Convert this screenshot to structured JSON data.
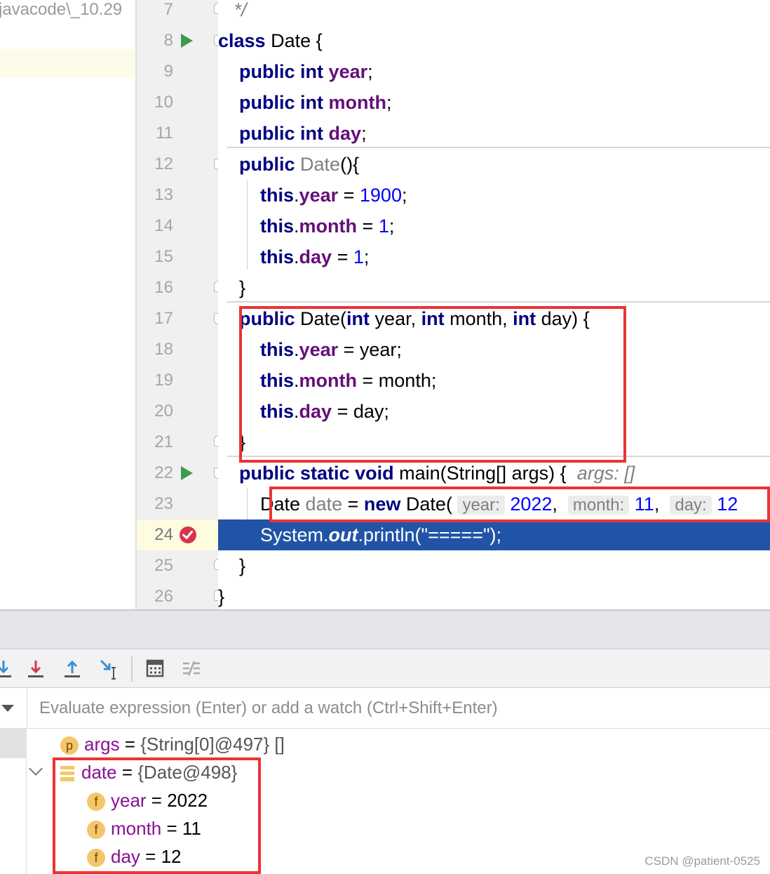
{
  "project": {
    "label": "javacode\\_10.29"
  },
  "editor": {
    "lines": [
      {
        "num": "7",
        "parts": [
          {
            "t": "   */",
            "c": "cmt"
          }
        ]
      },
      {
        "num": "8",
        "parts": [
          {
            "t": "class",
            "c": "kw"
          },
          {
            "t": " Date {"
          }
        ]
      },
      {
        "num": "9",
        "parts": [
          {
            "t": "    "
          },
          {
            "t": "public",
            "c": "kw"
          },
          {
            "t": " "
          },
          {
            "t": "int",
            "c": "kw"
          },
          {
            "t": " "
          },
          {
            "t": "year",
            "c": "fld"
          },
          {
            "t": ";"
          }
        ]
      },
      {
        "num": "10",
        "parts": [
          {
            "t": "    "
          },
          {
            "t": "public",
            "c": "kw"
          },
          {
            "t": " "
          },
          {
            "t": "int",
            "c": "kw"
          },
          {
            "t": " "
          },
          {
            "t": "month",
            "c": "fld"
          },
          {
            "t": ";"
          }
        ]
      },
      {
        "num": "11",
        "parts": [
          {
            "t": "    "
          },
          {
            "t": "public",
            "c": "kw"
          },
          {
            "t": " "
          },
          {
            "t": "int",
            "c": "kw"
          },
          {
            "t": " "
          },
          {
            "t": "day",
            "c": "fld"
          },
          {
            "t": ";"
          }
        ]
      },
      {
        "num": "12",
        "parts": [
          {
            "t": "    "
          },
          {
            "t": "public",
            "c": "kw"
          },
          {
            "t": " "
          },
          {
            "t": "Date",
            "c": "gray"
          },
          {
            "t": "(){"
          }
        ]
      },
      {
        "num": "13",
        "parts": [
          {
            "t": "        "
          },
          {
            "t": "this",
            "c": "kw"
          },
          {
            "t": "."
          },
          {
            "t": "year",
            "c": "fld"
          },
          {
            "t": " = "
          },
          {
            "t": "1900",
            "c": "num"
          },
          {
            "t": ";"
          }
        ]
      },
      {
        "num": "14",
        "parts": [
          {
            "t": "        "
          },
          {
            "t": "this",
            "c": "kw"
          },
          {
            "t": "."
          },
          {
            "t": "month",
            "c": "fld"
          },
          {
            "t": " = "
          },
          {
            "t": "1",
            "c": "num"
          },
          {
            "t": ";"
          }
        ]
      },
      {
        "num": "15",
        "parts": [
          {
            "t": "        "
          },
          {
            "t": "this",
            "c": "kw"
          },
          {
            "t": "."
          },
          {
            "t": "day",
            "c": "fld"
          },
          {
            "t": " = "
          },
          {
            "t": "1",
            "c": "num"
          },
          {
            "t": ";"
          }
        ]
      },
      {
        "num": "16",
        "parts": [
          {
            "t": "    }"
          }
        ]
      },
      {
        "num": "17",
        "parts": [
          {
            "t": "    "
          },
          {
            "t": "public",
            "c": "kw"
          },
          {
            "t": " Date("
          },
          {
            "t": "int",
            "c": "kw"
          },
          {
            "t": " year, "
          },
          {
            "t": "int",
            "c": "kw"
          },
          {
            "t": " month, "
          },
          {
            "t": "int",
            "c": "kw"
          },
          {
            "t": " day) {"
          }
        ]
      },
      {
        "num": "18",
        "parts": [
          {
            "t": "        "
          },
          {
            "t": "this",
            "c": "kw"
          },
          {
            "t": "."
          },
          {
            "t": "year",
            "c": "fld"
          },
          {
            "t": " = year;"
          }
        ]
      },
      {
        "num": "19",
        "parts": [
          {
            "t": "        "
          },
          {
            "t": "this",
            "c": "kw"
          },
          {
            "t": "."
          },
          {
            "t": "month",
            "c": "fld"
          },
          {
            "t": " = month;"
          }
        ]
      },
      {
        "num": "20",
        "parts": [
          {
            "t": "        "
          },
          {
            "t": "this",
            "c": "kw"
          },
          {
            "t": "."
          },
          {
            "t": "day",
            "c": "fld"
          },
          {
            "t": " = day;"
          }
        ]
      },
      {
        "num": "21",
        "parts": [
          {
            "t": "    }"
          }
        ]
      },
      {
        "num": "22",
        "parts": [
          {
            "t": "    "
          },
          {
            "t": "public",
            "c": "kw"
          },
          {
            "t": " "
          },
          {
            "t": "static",
            "c": "kw"
          },
          {
            "t": " "
          },
          {
            "t": "void",
            "c": "kw"
          },
          {
            "t": " main(String[] args) {  "
          },
          {
            "t": "args: []",
            "c": "hint"
          }
        ]
      },
      {
        "num": "23",
        "parts": [
          {
            "t": "        Date "
          },
          {
            "t": "date",
            "c": "gray"
          },
          {
            "t": " = "
          },
          {
            "t": "new",
            "c": "kw"
          },
          {
            "t": " Date( "
          },
          {
            "t": "year:",
            "c": "inlay"
          },
          {
            "t": " "
          },
          {
            "t": "2022",
            "c": "ivl"
          },
          {
            "t": ",  "
          },
          {
            "t": "month:",
            "c": "inlay"
          },
          {
            "t": " "
          },
          {
            "t": "11",
            "c": "ivl"
          },
          {
            "t": ",  "
          },
          {
            "t": "day:",
            "c": "inlay"
          },
          {
            "t": " "
          },
          {
            "t": "12",
            "c": "ivl"
          }
        ]
      },
      {
        "num": "24",
        "parts": [
          {
            "t": "        System."
          },
          {
            "t": "out",
            "c": "static"
          },
          {
            "t": ".println(\"=====\");"
          }
        ]
      },
      {
        "num": "25",
        "parts": [
          {
            "t": "    }"
          }
        ]
      },
      {
        "num": "26",
        "parts": [
          {
            "t": "}"
          }
        ]
      }
    ],
    "current_line": "24"
  },
  "debugger": {
    "watch_placeholder": "Evaluate expression (Enter) or add a watch (Ctrl+Shift+Enter)",
    "variables": [
      {
        "badge": "p",
        "name": "args",
        "eq": " = ",
        "value": "{String[0]@497} []",
        "level": 0
      },
      {
        "badge": "stack",
        "name": "date",
        "eq": " = ",
        "value": "{Date@498}",
        "level": 0
      },
      {
        "badge": "f",
        "name": "year",
        "eq": " = ",
        "value": "2022",
        "level": 1
      },
      {
        "badge": "f",
        "name": "month",
        "eq": " = ",
        "value": "11",
        "level": 1
      },
      {
        "badge": "f",
        "name": "day",
        "eq": " = ",
        "value": "12",
        "level": 1
      }
    ],
    "toolbar_icons": [
      "step-into-icon",
      "force-step-into-icon",
      "step-out-icon",
      "run-to-cursor-icon",
      "evaluate-expression-icon",
      "trace-stream-icon"
    ]
  },
  "colors": {
    "highlight_red": "#ea3436",
    "exec_line": "#2154a6",
    "keyword": "#000080",
    "field": "#660e7a"
  },
  "watermark": "CSDN @patient-0525"
}
